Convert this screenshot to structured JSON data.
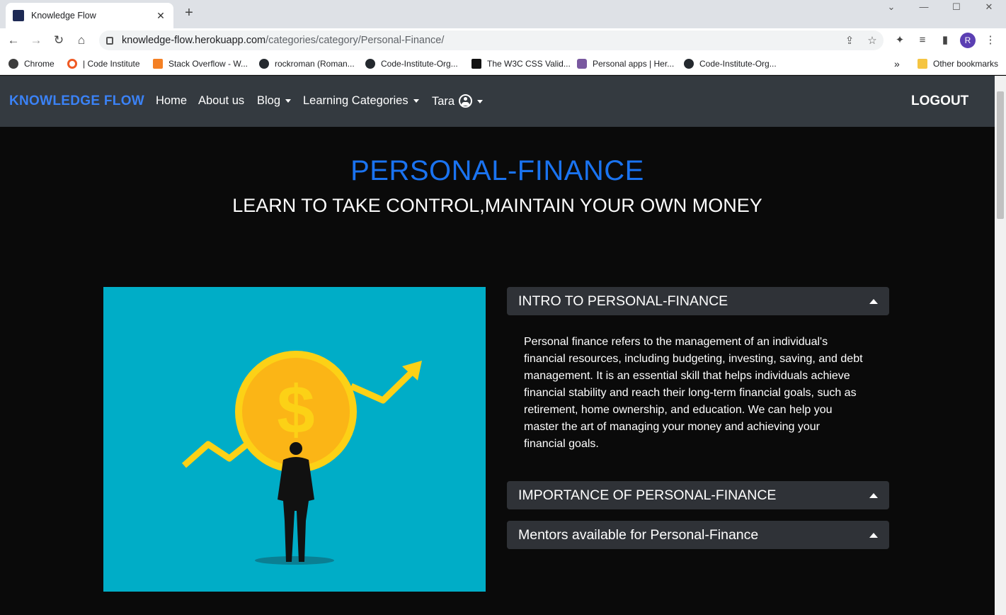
{
  "browser": {
    "tab_title": "Knowledge Flow",
    "url_host": "knowledge-flow.herokuapp.com",
    "url_path": "/categories/category/Personal-Finance/",
    "profile_initial": "R",
    "bookmarks": [
      {
        "label": "Chrome",
        "color": "#3c3c3c"
      },
      {
        "label": "| Code Institute",
        "color": "#ef5a24"
      },
      {
        "label": "Stack Overflow - W...",
        "color": "#f48024"
      },
      {
        "label": "rockroman (Roman...",
        "color": "#24292e"
      },
      {
        "label": "Code-Institute-Org...",
        "color": "#24292e"
      },
      {
        "label": "The W3C CSS Valid...",
        "color": "#111111"
      },
      {
        "label": "Personal apps | Her...",
        "color": "#79589f"
      },
      {
        "label": "Code-Institute-Org...",
        "color": "#24292e"
      }
    ],
    "bookmarks_more": "»",
    "other_bookmarks": "Other bookmarks"
  },
  "nav": {
    "brand": "KNOWLEDGE FLOW",
    "home": "Home",
    "about": "About us",
    "blog": "Blog",
    "categories": "Learning Categories",
    "user": "Tara",
    "logout": "LOGOUT"
  },
  "page": {
    "title": "PERSONAL-FINANCE",
    "subtitle": "LEARN TO TAKE CONTROL,MAINTAIN YOUR OWN MONEY"
  },
  "accordion": [
    {
      "label": "INTRO TO PERSONAL-FINANCE"
    },
    {
      "label": "IMPORTANCE OF PERSONAL-FINANCE"
    },
    {
      "label": "Mentors available for Personal-Finance"
    }
  ],
  "intro_text": "Personal finance refers to the management of an individual's financial resources, including budgeting, investing, saving, and debt management. It is an essential skill that helps individuals achieve financial stability and reach their long-term financial goals, such as retirement, home ownership, and education. We can help you master the art of managing your money and achieving your financial goals.",
  "colors": {
    "brand": "#3b82f6",
    "title": "#1a73f0",
    "navbar": "#343a40",
    "hero_bg": "#00adc7",
    "coin": "#fcc419"
  }
}
